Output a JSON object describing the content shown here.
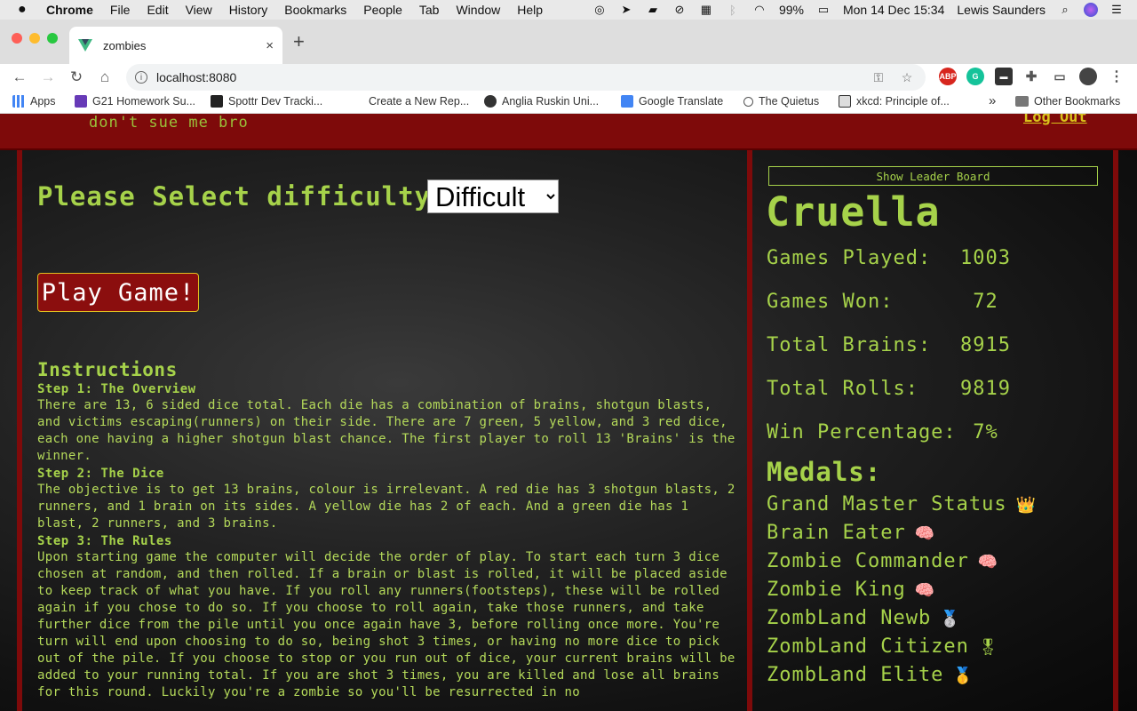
{
  "menubar": {
    "app": "Chrome",
    "items": [
      "File",
      "Edit",
      "View",
      "History",
      "Bookmarks",
      "People",
      "Tab",
      "Window",
      "Help"
    ],
    "battery": "99%",
    "datetime": "Mon 14 Dec  15:34",
    "user": "Lewis Saunders"
  },
  "tab": {
    "title": "zombies",
    "close": "×",
    "new_tab": "+"
  },
  "omnibox": {
    "url": "localhost:8080"
  },
  "bookmarks": {
    "items": [
      "Apps",
      "G21 Homework Su...",
      "Spottr Dev Tracki...",
      "Create a New Rep...",
      "Anglia Ruskin Uni...",
      "Google Translate",
      "The Quietus",
      "xkcd: Principle of..."
    ],
    "overflow": "»",
    "other": "Other Bookmarks"
  },
  "site": {
    "tagline": "don't sue me bro",
    "logout": "Log Out"
  },
  "game": {
    "difficulty_label": "Please Select difficulty",
    "difficulty_value": "Difficult",
    "play_button": "Play Game!"
  },
  "instructions": {
    "title": "Instructions",
    "steps": [
      {
        "heading": "Step 1: The Overview",
        "body": "There are 13, 6 sided dice total. Each die has a combination of brains, shotgun blasts, and victims escaping(runners) on their side. There are 7 green, 5 yellow, and 3 red dice, each one having a higher shotgun blast chance. The first player to roll 13 'Brains' is the winner."
      },
      {
        "heading": "Step 2: The Dice",
        "body": "The objective is to get 13 brains, colour is irrelevant. A red die has 3 shotgun blasts, 2 runners, and 1 brain on its sides. A yellow die has 2 of each. And a green die has 1 blast, 2 runners, and 3 brains."
      },
      {
        "heading": "Step 3: The Rules",
        "body": "Upon starting game the computer will decide the order of play. To start each turn 3 dice chosen at random, and then rolled. If a brain or blast is rolled, it will be placed aside to keep track of what you have. If you roll any runners(footsteps), these will be rolled again if you chose to do so. If you choose to roll again, take those runners, and take further dice from the pile until you once again have 3, before rolling once more. You're turn will end upon choosing to do so, being shot 3 times, or having no more dice to pick out of the pile. If you choose to stop or you run out of dice, your current brains will be added to your running total. If you are shot 3 times, you are killed and lose all brains for this round. Luckily you're a zombie so you'll be resurrected in no"
      }
    ]
  },
  "profile": {
    "leaderboard_button": "Show Leader Board",
    "username": "Cruella",
    "stats": [
      {
        "label": "Games Played:",
        "value": "1003"
      },
      {
        "label": "Games Won:",
        "value": " 72"
      },
      {
        "label": "Total Brains:",
        "value": "8915"
      },
      {
        "label": "Total Rolls:",
        "value": "9819"
      },
      {
        "label": "Win Percentage:",
        "value": " 7%"
      }
    ],
    "medals_title": "Medals:",
    "medals": [
      {
        "name": "Grand Master Status",
        "emoji": "👑"
      },
      {
        "name": "Brain Eater",
        "emoji": "🧠"
      },
      {
        "name": "Zombie Commander",
        "emoji": "🧠"
      },
      {
        "name": "Zombie King",
        "emoji": "🧠"
      },
      {
        "name": "ZombLand Newb",
        "emoji": "🥈"
      },
      {
        "name": "ZombLand Citizen",
        "emoji": "🎖"
      },
      {
        "name": "ZombLand Elite",
        "emoji": "🥇"
      }
    ]
  },
  "colors": {
    "accent_green": "#a6d24a",
    "header_red": "#7e0a0a",
    "button_border": "#e0c020"
  }
}
